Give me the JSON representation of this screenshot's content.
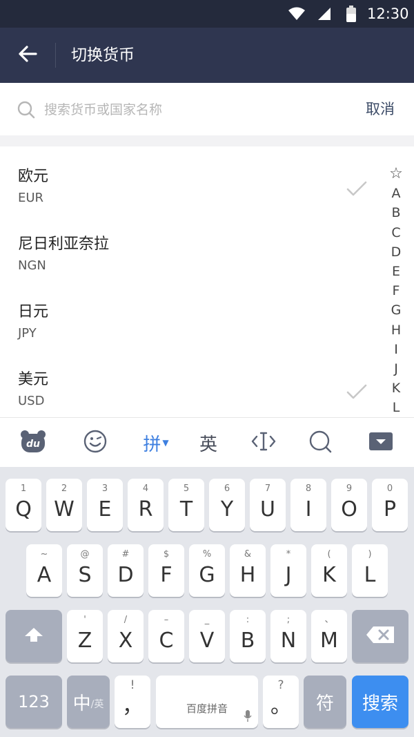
{
  "status_bar": {
    "time": "12:30"
  },
  "app_bar": {
    "title": "切换货币"
  },
  "search": {
    "placeholder": "搜索货币或国家名称",
    "cancel_label": "取消"
  },
  "currencies": [
    {
      "name": "欧元",
      "code": "EUR",
      "selected": true
    },
    {
      "name": "尼日利亚奈拉",
      "code": "NGN",
      "selected": false
    },
    {
      "name": "日元",
      "code": "JPY",
      "selected": false
    },
    {
      "name": "美元",
      "code": "USD",
      "selected": true
    }
  ],
  "index_letters": [
    "☆",
    "A",
    "B",
    "C",
    "D",
    "E",
    "F",
    "G",
    "H",
    "I",
    "J",
    "K",
    "L"
  ],
  "keyboard_toolbar": {
    "pinyin_label": "拼",
    "english_label": "英"
  },
  "keyboard": {
    "row1": [
      {
        "sub": "1",
        "main": "Q"
      },
      {
        "sub": "2",
        "main": "W"
      },
      {
        "sub": "3",
        "main": "E"
      },
      {
        "sub": "4",
        "main": "R"
      },
      {
        "sub": "5",
        "main": "T"
      },
      {
        "sub": "6",
        "main": "Y"
      },
      {
        "sub": "7",
        "main": "U"
      },
      {
        "sub": "8",
        "main": "I"
      },
      {
        "sub": "9",
        "main": "O"
      },
      {
        "sub": "0",
        "main": "P"
      }
    ],
    "row2": [
      {
        "sub": "~",
        "main": "A"
      },
      {
        "sub": "@",
        "main": "S"
      },
      {
        "sub": "#",
        "main": "D"
      },
      {
        "sub": "$",
        "main": "F"
      },
      {
        "sub": "%",
        "main": "G"
      },
      {
        "sub": "&",
        "main": "H"
      },
      {
        "sub": "*",
        "main": "J"
      },
      {
        "sub": "(",
        "main": "K"
      },
      {
        "sub": ")",
        "main": "L"
      }
    ],
    "row3": [
      {
        "sub": "'",
        "main": "Z"
      },
      {
        "sub": "/",
        "main": "X"
      },
      {
        "sub": "–",
        "main": "C"
      },
      {
        "sub": "_",
        "main": "V"
      },
      {
        "sub": ":",
        "main": "B"
      },
      {
        "sub": ";",
        "main": "N"
      },
      {
        "sub": "、",
        "main": "M"
      }
    ],
    "num_label": "123",
    "lang_main": "中",
    "lang_sub": "/英",
    "comma_sub": "!",
    "comma_main": "，",
    "space_label": "百度拼音",
    "period_sub": "?",
    "period_main": "。",
    "symbol_label": "符",
    "search_label": "搜索"
  },
  "colors": {
    "header": "#2f3650",
    "status": "#242a3c",
    "accent": "#3d8ef0"
  }
}
